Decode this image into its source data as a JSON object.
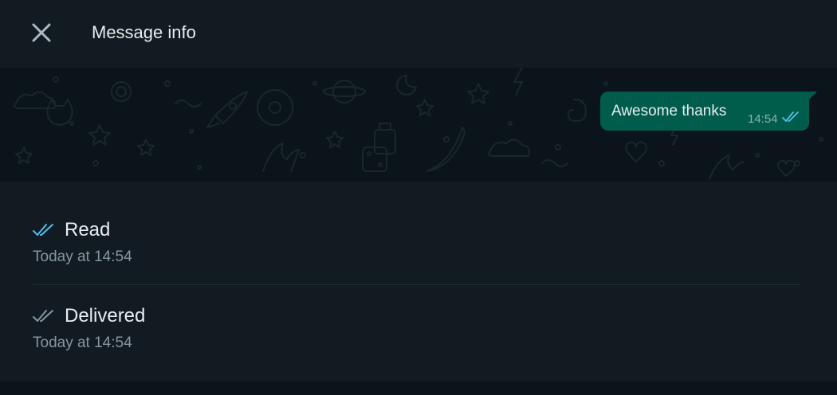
{
  "header": {
    "title": "Message info",
    "close_icon": "close-icon"
  },
  "message": {
    "text": "Awesome thanks",
    "time": "14:54",
    "status_icon": "double-check-read-icon",
    "bubble_color": "#005c4b"
  },
  "receipts": [
    {
      "label": "Read",
      "time": "Today at 14:54",
      "icon": "double-check-read-icon",
      "icon_color": "#53bdeb"
    },
    {
      "label": "Delivered",
      "time": "Today at 14:54",
      "icon": "double-check-delivered-icon",
      "icon_color": "#8696a0"
    }
  ],
  "colors": {
    "header_bg": "#111b21",
    "panel_bg": "#111b21",
    "chat_bg": "#0b141a",
    "primary_text": "#e9edef",
    "secondary_text": "#8696a0"
  }
}
